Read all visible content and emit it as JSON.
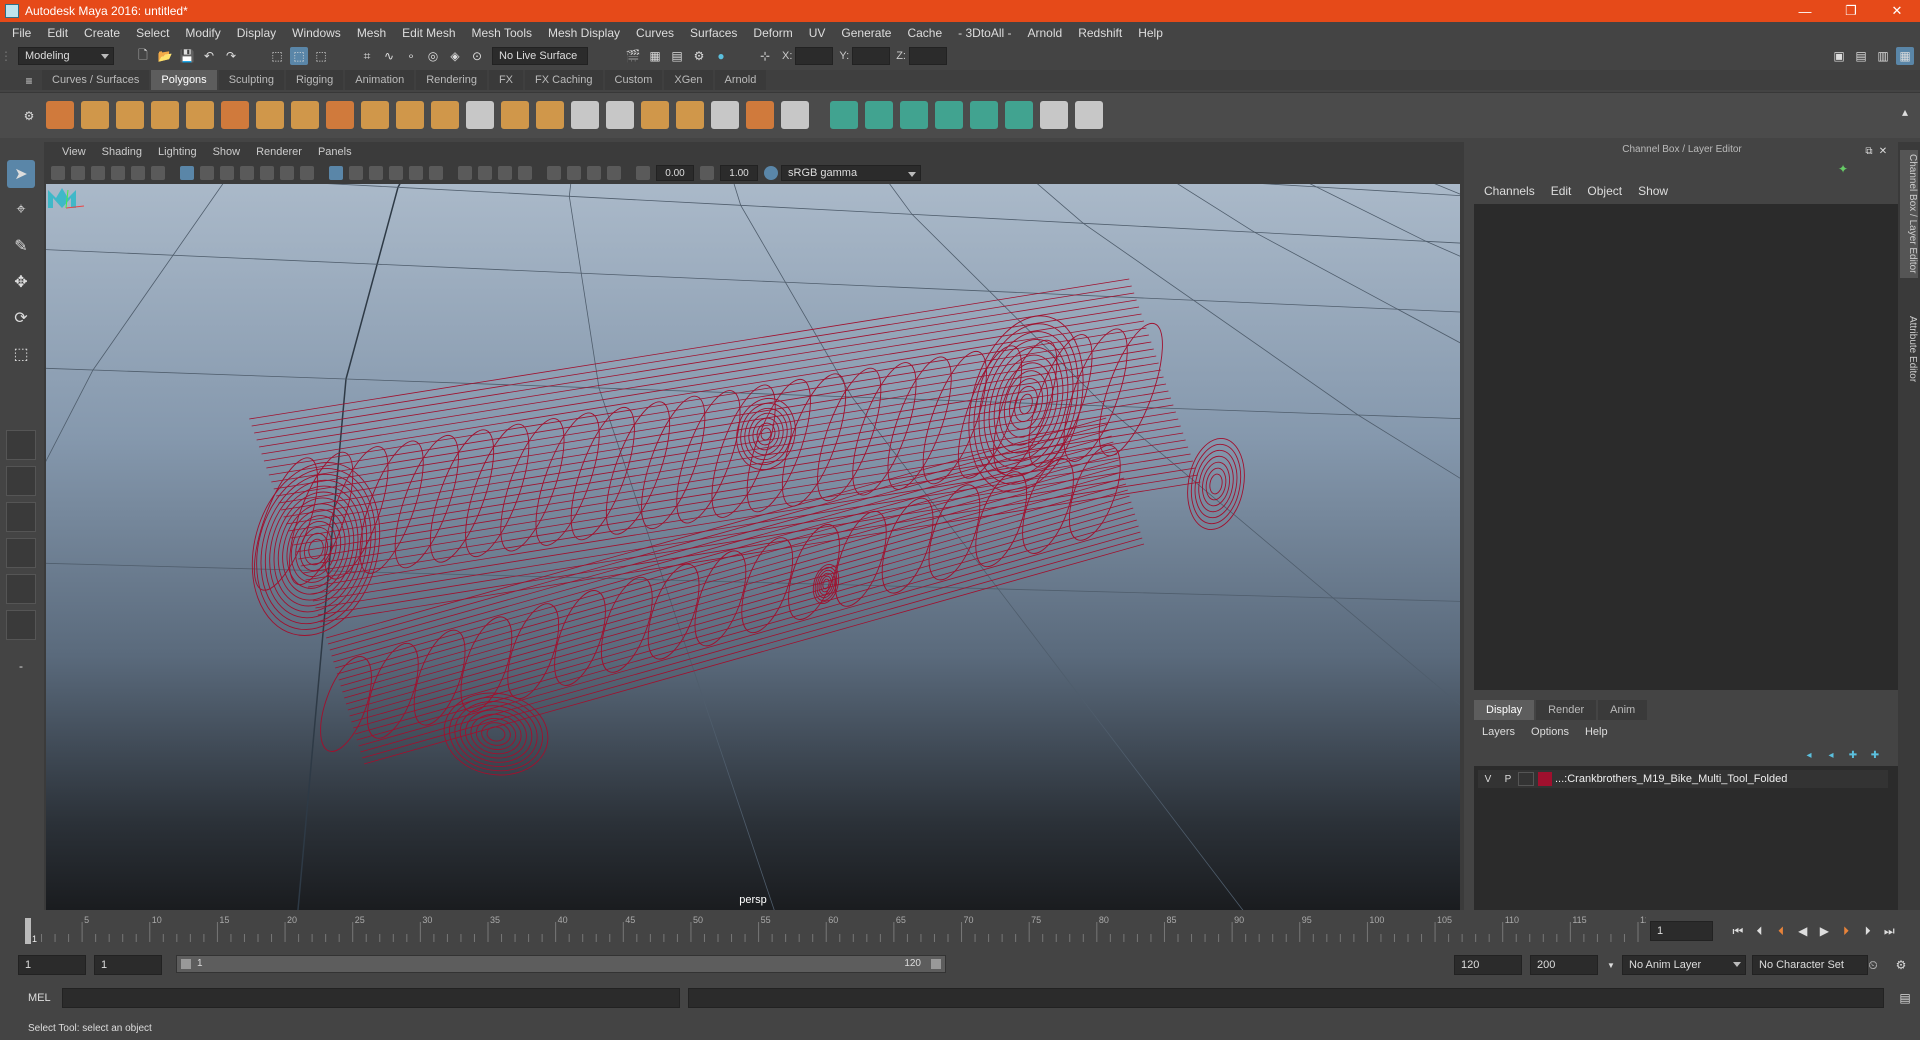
{
  "window": {
    "title": "Autodesk Maya 2016: untitled*",
    "controls": [
      "—",
      "❐",
      "✕"
    ]
  },
  "menubar": [
    "File",
    "Edit",
    "Create",
    "Select",
    "Modify",
    "Display",
    "Windows",
    "Mesh",
    "Edit Mesh",
    "Mesh Tools",
    "Mesh Display",
    "Curves",
    "Surfaces",
    "Deform",
    "UV",
    "Generate",
    "Cache",
    "- 3DtoAll -",
    "Arnold",
    "Redshift",
    "Help"
  ],
  "statusline": {
    "mode": "Modeling",
    "live_surface": "No Live Surface",
    "x_label": "X:",
    "y_label": "Y:",
    "z_label": "Z:"
  },
  "shelf_tabs": [
    "Curves / Surfaces",
    "Polygons",
    "Sculpting",
    "Rigging",
    "Animation",
    "Rendering",
    "FX",
    "FX Caching",
    "Custom",
    "XGen",
    "Arnold"
  ],
  "shelf_active_tab": "Polygons",
  "viewport": {
    "menu": [
      "View",
      "Shading",
      "Lighting",
      "Show",
      "Renderer",
      "Panels"
    ],
    "exposure": "0.00",
    "gamma": "1.00",
    "color_space": "sRGB gamma",
    "camera": "persp",
    "wire_color": "#a0102e"
  },
  "channel_box": {
    "title": "Channel Box / Layer Editor",
    "menu": [
      "Channels",
      "Edit",
      "Object",
      "Show"
    ]
  },
  "layer_editor": {
    "tabs": [
      "Display",
      "Render",
      "Anim"
    ],
    "menu": [
      "Layers",
      "Options",
      "Help"
    ],
    "layer": {
      "visible": "V",
      "playback": "P",
      "name": "...:Crankbrothers_M19_Bike_Multi_Tool_Folded",
      "color": "#a0102e"
    }
  },
  "side_tabs": [
    "Channel Box / Layer Editor",
    "Attribute Editor"
  ],
  "timeline": {
    "ticks": [
      "5",
      "10",
      "15",
      "20",
      "25",
      "30",
      "35",
      "40",
      "45",
      "50",
      "55",
      "60",
      "65",
      "70",
      "75",
      "80",
      "85",
      "90",
      "95",
      "100",
      "105",
      "110",
      "115",
      "120"
    ],
    "current_frame": "1",
    "current_field": "1"
  },
  "range": {
    "start": "1",
    "start_inner": "1",
    "slider_start": "1",
    "slider_end": "120",
    "end_inner": "120",
    "end": "200",
    "anim_layer": "No Anim Layer",
    "character_set": "No Character Set"
  },
  "command": {
    "label": "MEL"
  },
  "help_line": "Select Tool: select an object"
}
